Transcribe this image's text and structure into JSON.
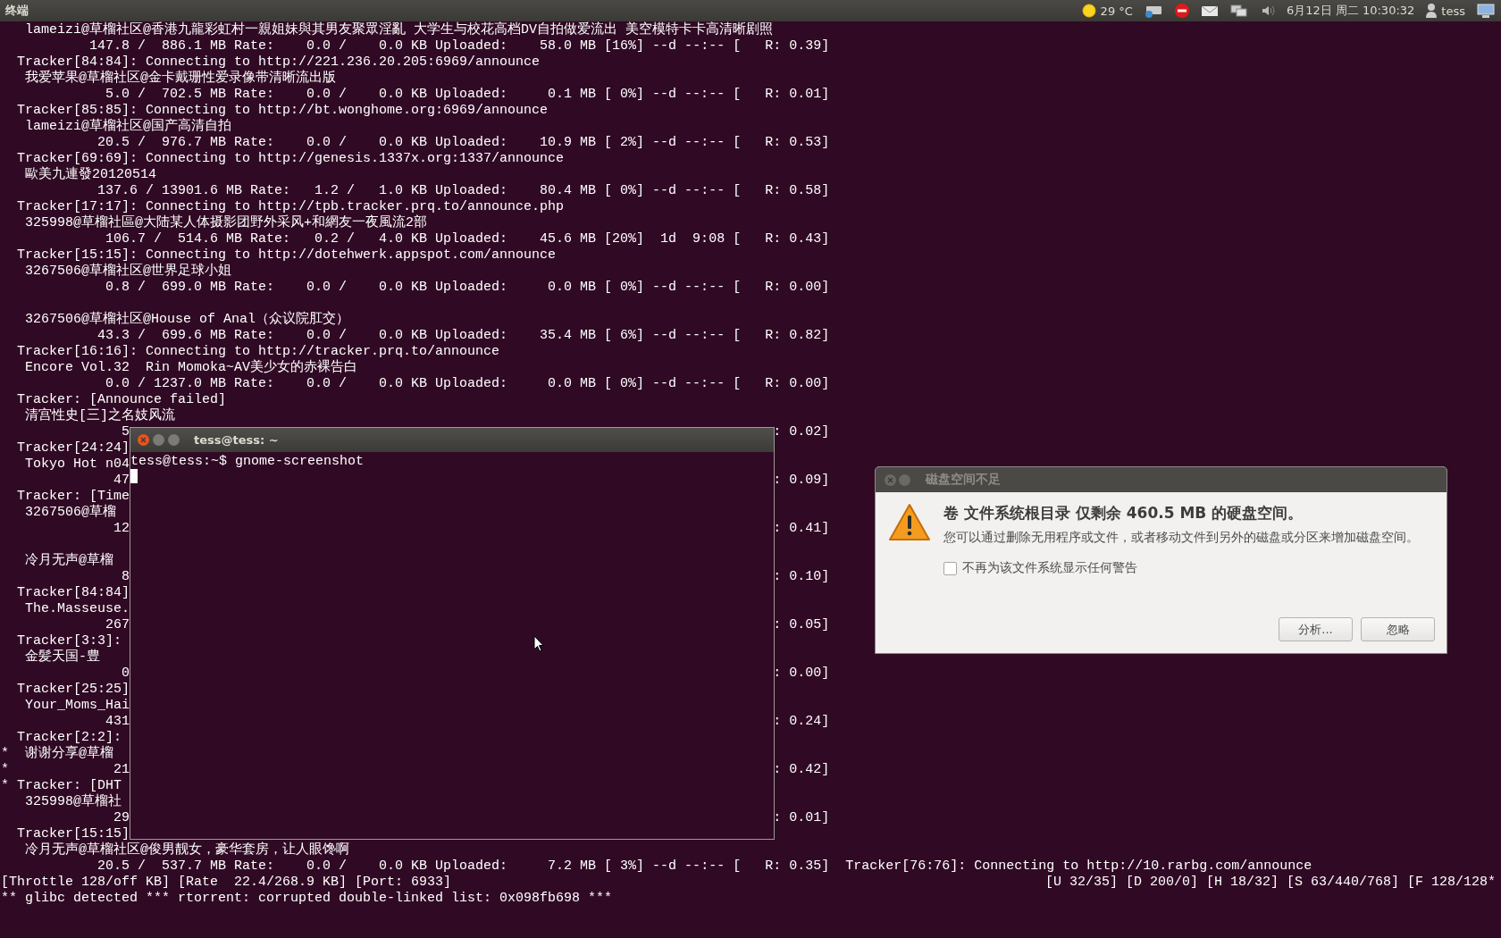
{
  "top_bar": {
    "app_title": "终端",
    "weather": "29 °C",
    "clock": "6月12日 周二 10:30:32",
    "user": "tess"
  },
  "terminal": {
    "lines": [
      {
        "kind": "name",
        "text": "lameizi@草榴社区@香港九龍彩虹村一親姐妹與其男友聚眾淫亂 大学生与校花高档DV自拍做爱流出 美空模特卡卡高清晰剧照"
      },
      {
        "kind": "stats",
        "text": "147.8 /  886.1 MB Rate:    0.0 /    0.0 KB Uploaded:    58.0 MB [16%] --d --:-- [   R: 0.39]"
      },
      {
        "kind": "tracker",
        "text": "Tracker[84:84]: Connecting to http://221.236.20.205:6969/announce"
      },
      {
        "kind": "name",
        "text": "我爱苹果@草榴社区@金卡戴珊性爱录像带清晰流出版"
      },
      {
        "kind": "stats",
        "text": "5.0 /  702.5 MB Rate:    0.0 /    0.0 KB Uploaded:     0.1 MB [ 0%] --d --:-- [   R: 0.01]"
      },
      {
        "kind": "tracker",
        "text": "Tracker[85:85]: Connecting to http://bt.wonghome.org:6969/announce"
      },
      {
        "kind": "name",
        "text": "lameizi@草榴社区@国产高清自拍"
      },
      {
        "kind": "stats",
        "text": "20.5 /  976.7 MB Rate:    0.0 /    0.0 KB Uploaded:    10.9 MB [ 2%] --d --:-- [   R: 0.53]"
      },
      {
        "kind": "tracker",
        "text": "Tracker[69:69]: Connecting to http://genesis.1337x.org:1337/announce"
      },
      {
        "kind": "name",
        "text": "歐美九連發20120514"
      },
      {
        "kind": "stats",
        "text": "137.6 / 13901.6 MB Rate:   1.2 /   1.0 KB Uploaded:    80.4 MB [ 0%] --d --:-- [   R: 0.58]"
      },
      {
        "kind": "tracker",
        "text": "Tracker[17:17]: Connecting to http://tpb.tracker.prq.to/announce.php"
      },
      {
        "kind": "name",
        "text": "325998@草榴社區@大陆某人体摄影团野外采风+和網友一夜風流2部"
      },
      {
        "kind": "stats",
        "text": "106.7 /  514.6 MB Rate:   0.2 /   4.0 KB Uploaded:    45.6 MB [20%]  1d  9:08 [   R: 0.43]"
      },
      {
        "kind": "tracker",
        "text": "Tracker[15:15]: Connecting to http://dotehwerk.appspot.com/announce"
      },
      {
        "kind": "name",
        "text": "3267506@草榴社区@世界足球小姐"
      },
      {
        "kind": "stats",
        "text": "0.8 /  699.0 MB Rate:    0.0 /    0.0 KB Uploaded:     0.0 MB [ 0%] --d --:-- [   R: 0.00]"
      },
      {
        "kind": "blank"
      },
      {
        "kind": "name",
        "text": "3267506@草榴社区@House of Anal（众议院肛交）"
      },
      {
        "kind": "stats",
        "text": "43.3 /  699.6 MB Rate:    0.0 /    0.0 KB Uploaded:    35.4 MB [ 6%] --d --:-- [   R: 0.82]"
      },
      {
        "kind": "tracker",
        "text": "Tracker[16:16]: Connecting to http://tracker.prq.to/announce"
      },
      {
        "kind": "name",
        "text": "Encore Vol.32  Rin Momoka~AV美少女的赤裸告白"
      },
      {
        "kind": "stats",
        "text": "0.0 / 1237.0 MB Rate:    0.0 /    0.0 KB Uploaded:     0.0 MB [ 0%] --d --:-- [   R: 0.00]"
      },
      {
        "kind": "tracker",
        "text": "Tracker: [Announce failed]"
      },
      {
        "kind": "name",
        "text": "清宫性史[三]之名妓风流"
      },
      {
        "kind": "stats_cut",
        "text": "5",
        "tail": ": 0.02]"
      },
      {
        "kind": "tracker",
        "text": "Tracker[24:24]"
      },
      {
        "kind": "name",
        "text": "Tokyo Hot n04"
      },
      {
        "kind": "stats_cut",
        "text": "47",
        "tail": ": 0.09]"
      },
      {
        "kind": "tracker",
        "text": "Tracker: [Time"
      },
      {
        "kind": "name",
        "text": "3267506@草榴"
      },
      {
        "kind": "stats_cut",
        "text": "12",
        "tail": ": 0.41]"
      },
      {
        "kind": "blank"
      },
      {
        "kind": "name",
        "text": "冷月无声@草榴"
      },
      {
        "kind": "stats_cut",
        "text": "8",
        "tail": ": 0.10]"
      },
      {
        "kind": "tracker",
        "text": "Tracker[84:84]"
      },
      {
        "kind": "name",
        "text": "The.Masseuse."
      },
      {
        "kind": "stats_cut",
        "text": "267",
        "tail": ": 0.05]"
      },
      {
        "kind": "tracker",
        "text": "Tracker[3:3]:"
      },
      {
        "kind": "name",
        "text": "金髪天国-豊"
      },
      {
        "kind": "stats_cut",
        "text": "0",
        "tail": ": 0.00]"
      },
      {
        "kind": "tracker",
        "text": "Tracker[25:25]"
      },
      {
        "kind": "name",
        "text": "Your_Moms_Hai"
      },
      {
        "kind": "stats_cut",
        "text": "431",
        "tail": ": 0.24]"
      },
      {
        "kind": "tracker",
        "text": "Tracker[2:2]:"
      },
      {
        "kind": "name",
        "bullet": "*",
        "text": "谢谢分享@草榴"
      },
      {
        "kind": "stats_cut",
        "bullet": "*",
        "text": "21",
        "tail": ": 0.42]"
      },
      {
        "kind": "tracker",
        "bullet": "*",
        "text": "Tracker: [DHT"
      },
      {
        "kind": "name",
        "text": "325998@草榴社"
      },
      {
        "kind": "stats_cut",
        "text": "29",
        "tail": ": 0.01]"
      },
      {
        "kind": "tracker",
        "text": "Tracker[15:15]"
      },
      {
        "kind": "name",
        "text": "冷月无声@草榴社区@俊男靓女，豪华套房，让人眼馋啊"
      },
      {
        "kind": "stats",
        "text": "20.5 /  537.7 MB Rate:    0.0 /    0.0 KB Uploaded:     7.2 MB [ 3%] --d --:-- [   R: 0.35]",
        "extra": "Tracker[76:76]: Connecting to http://10.rarbg.com/announce"
      },
      {
        "kind": "status",
        "text": "[Throttle 128/off KB] [Rate  22.4/268.9 KB] [Port: 6933]",
        "right": "[U 32/35] [D 200/0] [H 18/32] [S 63/440/768] [F 128/128*"
      },
      {
        "kind": "plain",
        "text": "** glibc detected *** rtorrent: corrupted double-linked list: 0x098fb698 ***"
      }
    ]
  },
  "small_terminal": {
    "title": "tess@tess: ~",
    "prompt": "tess@tess:~$ gnome-screenshot"
  },
  "dialog": {
    "title": "磁盘空间不足",
    "heading": "卷 文件系统根目录 仅剩余 460.5 MB 的硬盘空间。",
    "message": "您可以通过删除无用程序或文件，或者移动文件到另外的磁盘或分区来增加磁盘空间。",
    "checkbox": {
      "label": "不再为该文件系统显示任何警告",
      "checked": false
    },
    "buttons": [
      "分析...",
      "忽略"
    ]
  }
}
